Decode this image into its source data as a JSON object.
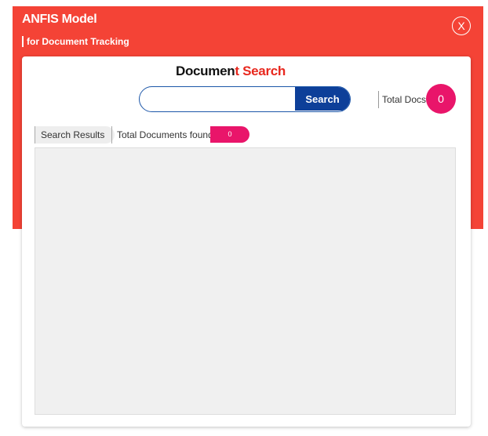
{
  "header": {
    "title": "ANFIS Model",
    "subtitle": "for Document Tracking",
    "close_label": "X"
  },
  "search": {
    "title_prefix": "Documen",
    "title_accent": "t Search",
    "input_value": "",
    "placeholder": "",
    "button_label": "Search"
  },
  "totals": {
    "label": "Total Docs",
    "count": "0"
  },
  "results": {
    "tab_label": "Search Results",
    "found_label": "Total Documents found:",
    "found_count": "0"
  },
  "colors": {
    "header_red": "#f44336",
    "accent_pink": "#e9156a",
    "search_blue": "#0d3f99",
    "title_red": "#e8281e"
  }
}
